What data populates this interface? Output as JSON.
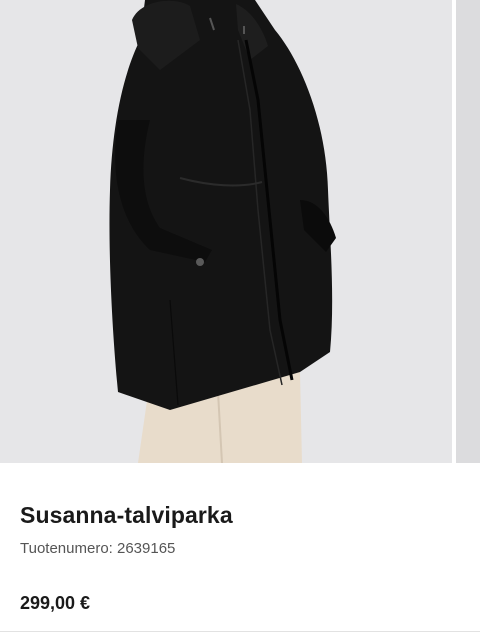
{
  "product": {
    "name": "Susanna-talviparka",
    "sku_text": "Tuotenumero: 2639165",
    "price": "299,00 €"
  },
  "image": {
    "subject": "black-winter-parka-photo",
    "background_color": "#e6e6e8",
    "garment_color": "#141414",
    "pants_color": "#e8dccb"
  }
}
